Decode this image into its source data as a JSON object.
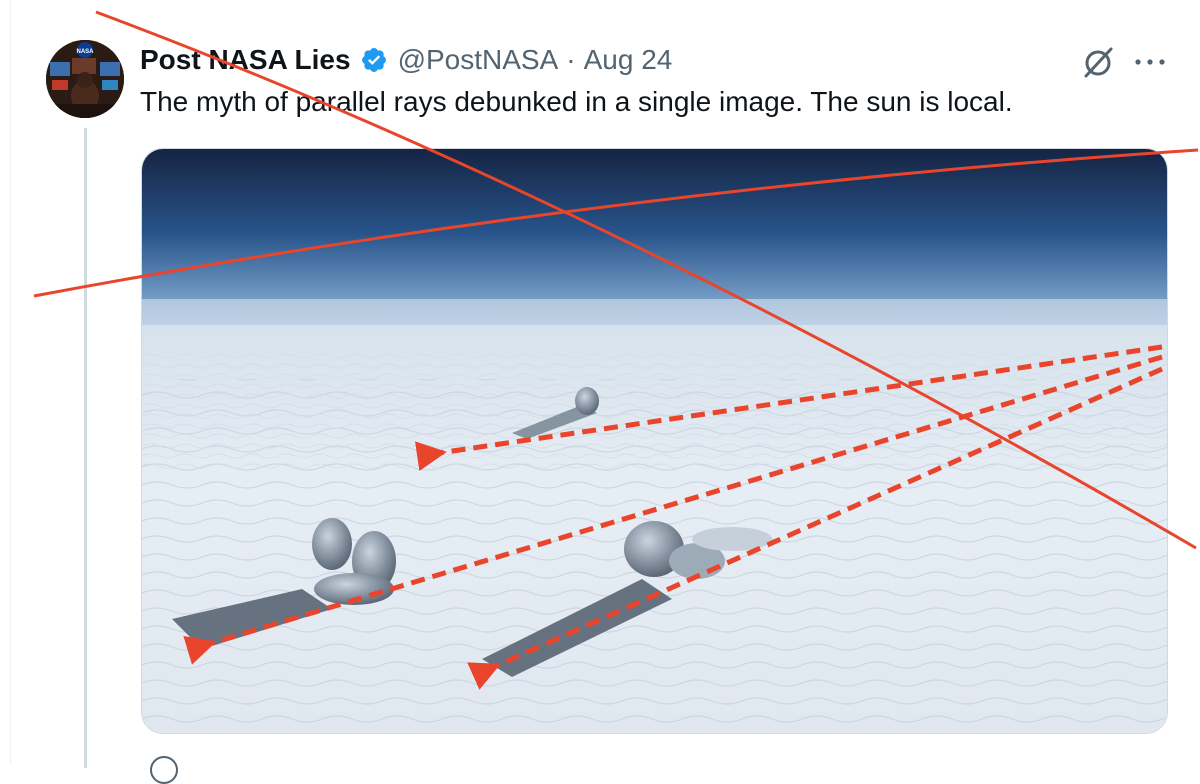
{
  "tweet": {
    "display_name": "Post NASA Lies",
    "handle": "@PostNASA",
    "separator": "·",
    "date": "Aug 24",
    "text": "The myth of parallel rays debunked in a single image. The sun is local."
  },
  "avatar": {
    "badge_text": "NASA"
  },
  "icons": {
    "verified": "verified-badge-icon",
    "grok": "grok-icon",
    "more": "more-icon"
  },
  "colors": {
    "verified_blue": "#1d9bf0",
    "annotation_red": "#e8452c",
    "muted_text": "#536471"
  }
}
